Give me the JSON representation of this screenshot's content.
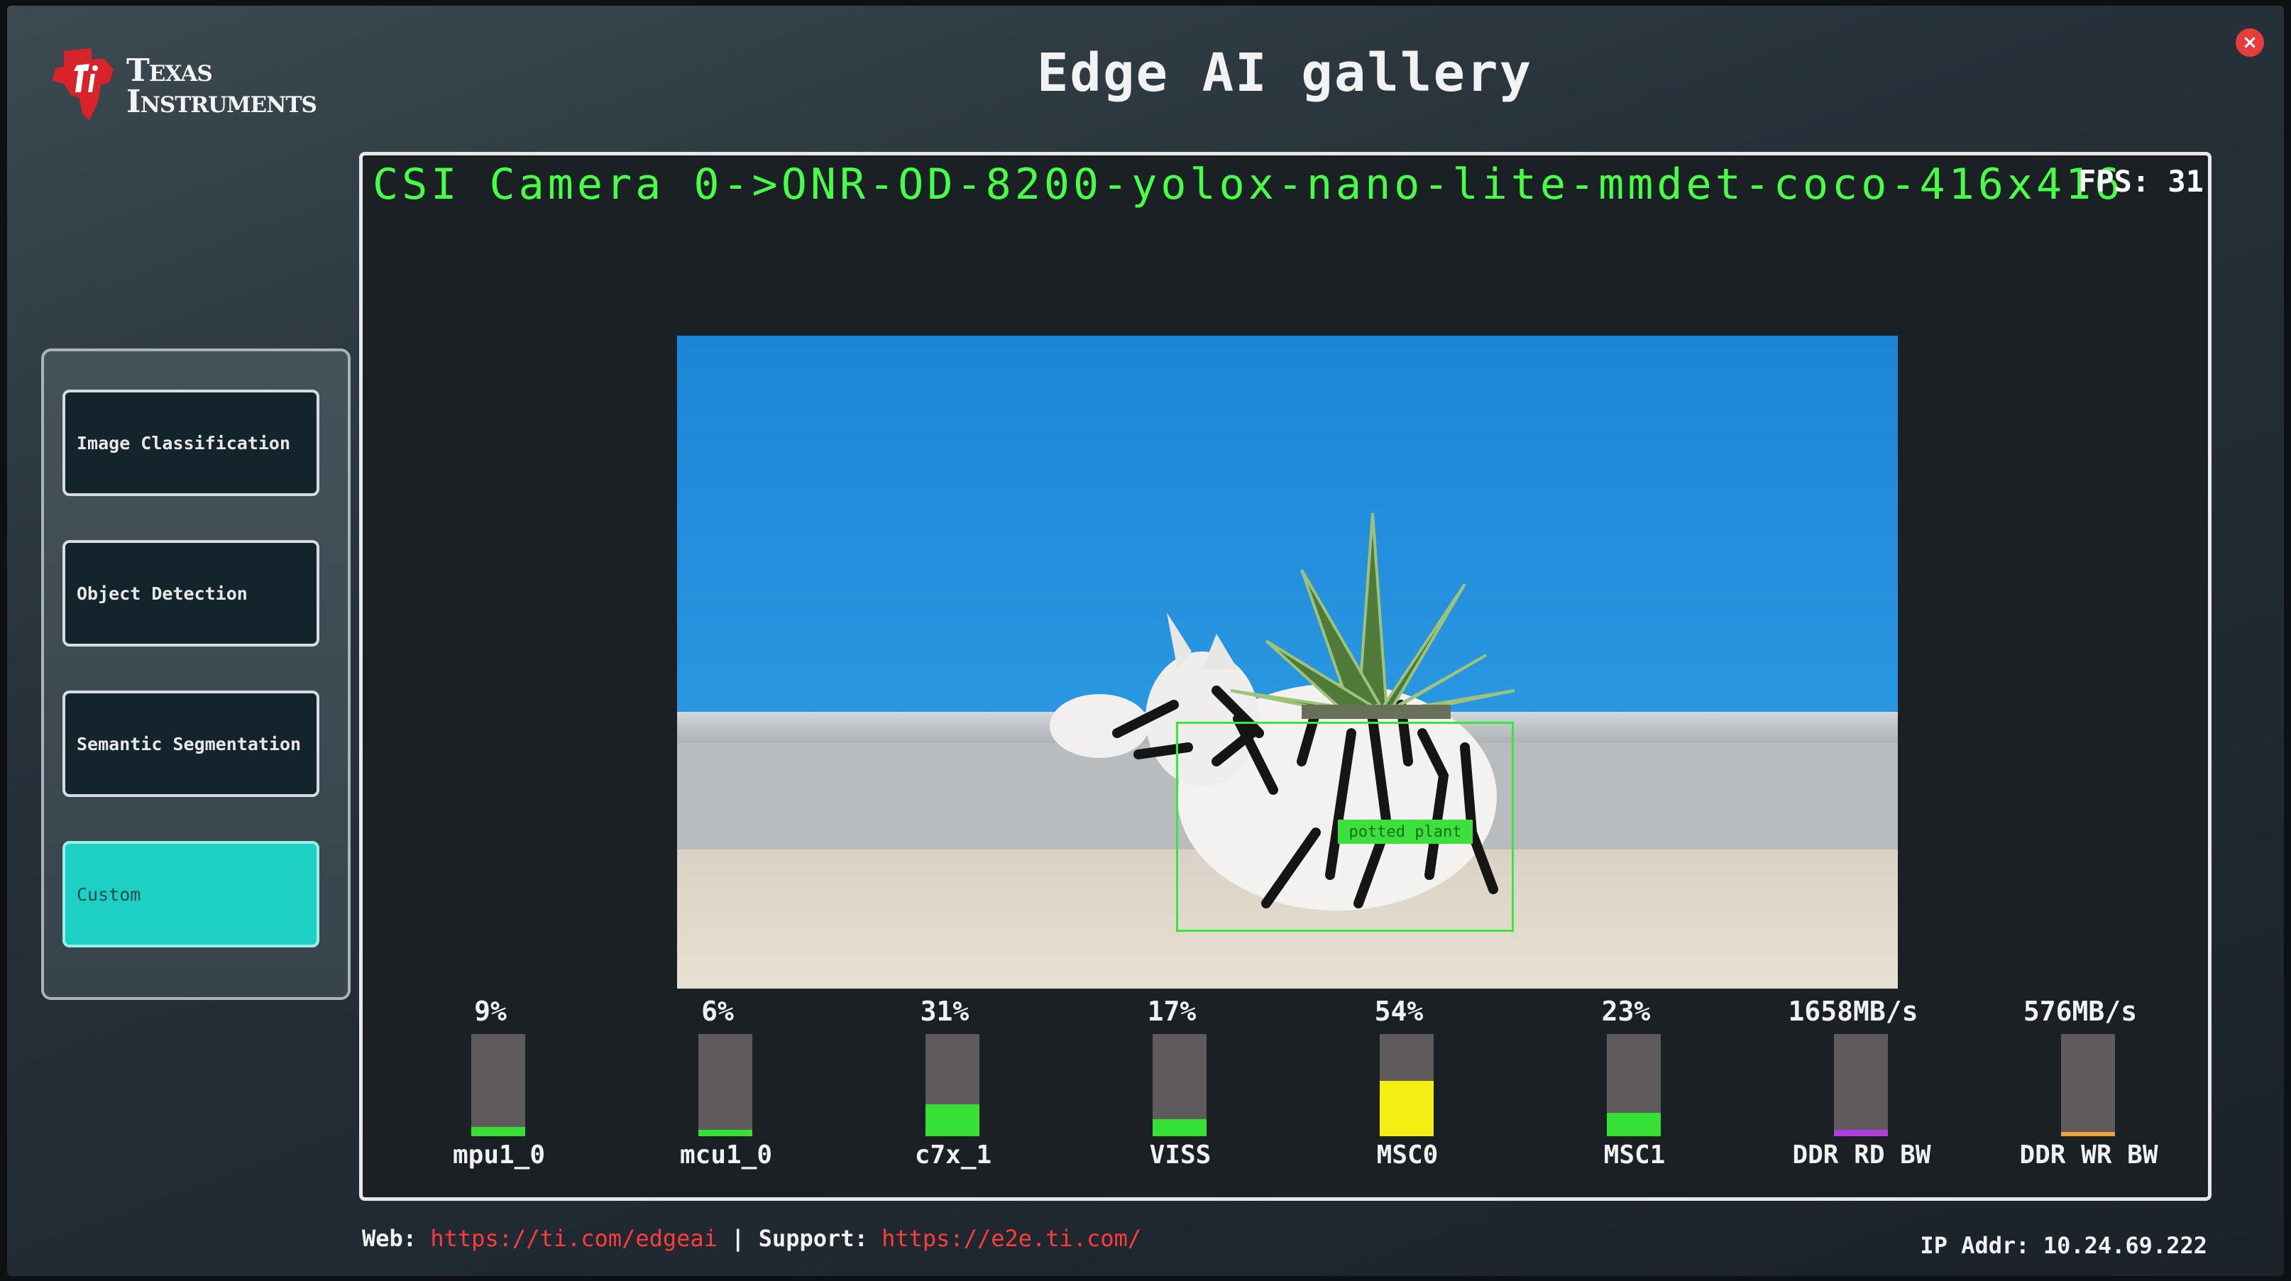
{
  "app": {
    "brand_line1": "Texas",
    "brand_line2": "Instruments",
    "title": "Edge AI gallery",
    "close_label": "×"
  },
  "colors": {
    "accent_teal": "#1ecfc3",
    "pipeline_green": "#46ff46",
    "link_red": "#ff3b3b",
    "ti_red": "#d8232a"
  },
  "sidebar": {
    "items": [
      {
        "label": "Image Classification",
        "active": false
      },
      {
        "label": "Object Detection",
        "active": false
      },
      {
        "label": "Semantic Segmentation",
        "active": false
      },
      {
        "label": "Custom",
        "active": true
      }
    ]
  },
  "viewer": {
    "pipeline": "CSI Camera 0->ONR-OD-8200-yolox-nano-lite-mmdet-coco-416x416",
    "fps": "FPS: 31",
    "detection_label": "potted plant"
  },
  "stats": [
    {
      "value": "9%",
      "name": "mpu1_0",
      "level": 0.09,
      "color": "#37e035"
    },
    {
      "value": "6%",
      "name": "mcu1_0",
      "level": 0.06,
      "color": "#37e035"
    },
    {
      "value": "31%",
      "name": "c7x_1",
      "level": 0.31,
      "color": "#37e035"
    },
    {
      "value": "17%",
      "name": "VISS",
      "level": 0.17,
      "color": "#37e035"
    },
    {
      "value": "54%",
      "name": "MSC0",
      "level": 0.54,
      "color": "#f4ee13"
    },
    {
      "value": "23%",
      "name": "MSC1",
      "level": 0.23,
      "color": "#37e035"
    },
    {
      "value": "1658MB/s",
      "name": "DDR RD BW",
      "level": 0.06,
      "color": "#b23cdd"
    },
    {
      "value": "576MB/s",
      "name": "DDR WR BW",
      "level": 0.04,
      "color": "#f0a13a"
    }
  ],
  "footer": {
    "web_label": "Web:",
    "web_link": "https://ti.com/edgeai",
    "separator": "|",
    "support_label": "Support:",
    "support_link": "https://e2e.ti.com/",
    "ip": "IP Addr: 10.24.69.222"
  }
}
